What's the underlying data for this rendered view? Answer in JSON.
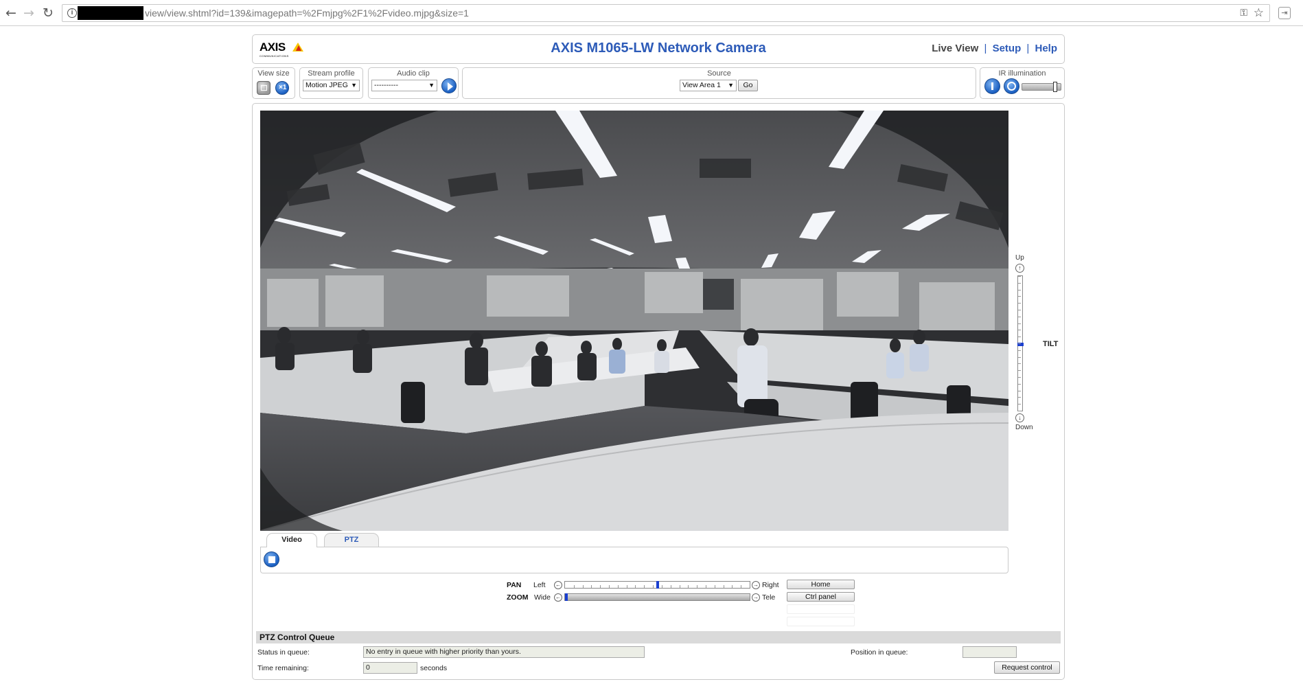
{
  "browser": {
    "url": "view/view.shtml?id=139&imagepath=%2Fmjpg%2F1%2Fvideo.mjpg&size=1"
  },
  "header": {
    "logo_text": "AXIS",
    "logo_sub": "COMMUNICATIONS",
    "title": "AXIS M1065-LW Network Camera",
    "nav": {
      "live_view": "Live View",
      "setup": "Setup",
      "help": "Help",
      "separator": "|"
    }
  },
  "toolbar": {
    "view_size": {
      "label": "View size"
    },
    "stream_profile": {
      "label": "Stream profile",
      "value": "Motion JPEG"
    },
    "audio_clip": {
      "label": "Audio clip",
      "value": "----------"
    },
    "source": {
      "label": "Source",
      "value": "View Area 1",
      "go": "Go"
    },
    "ir": {
      "label": "IR illumination",
      "level_fraction": 0.9
    }
  },
  "tilt": {
    "up": "Up",
    "down": "Down",
    "name": "TILT",
    "position_fraction": 0.5
  },
  "tabs": {
    "video": "Video",
    "ptz": "PTZ"
  },
  "ptz": {
    "pan": {
      "name": "PAN",
      "left": "Left",
      "right": "Right",
      "position_fraction": 0.5
    },
    "zoom": {
      "name": "ZOOM",
      "left": "Wide",
      "right": "Tele",
      "position_fraction": 0.0
    },
    "home": "Home",
    "ctrl_panel": "Ctrl panel"
  },
  "queue": {
    "title": "PTZ Control Queue",
    "status_label": "Status in queue:",
    "status_value": "No entry in queue with higher priority than yours.",
    "position_label": "Position in queue:",
    "position_value": "",
    "time_label": "Time remaining:",
    "time_value": "0",
    "time_unit": "seconds",
    "request": "Request control"
  },
  "colors": {
    "accent": "#2d5bb8",
    "slider_thumb": "#1a3fd0",
    "logo_yellow": "#f7c600",
    "logo_red": "#d8231b"
  }
}
